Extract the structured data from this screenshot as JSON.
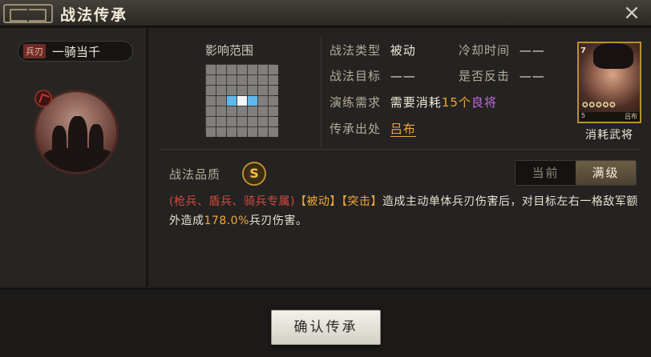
{
  "window": {
    "title": "战法传承",
    "close_icon": "×"
  },
  "skill": {
    "troop_type": "兵刃",
    "name": "一骑当千",
    "icon": "cavalry-charge-portrait"
  },
  "range": {
    "label": "影响范围",
    "grid_size": 7,
    "target_cells": [
      [
        3,
        2
      ],
      [
        3,
        4
      ]
    ],
    "self_cell": [
      3,
      3
    ]
  },
  "info": {
    "type_label": "战法类型",
    "type_value": "被动",
    "cooldown_label": "冷却时间",
    "cooldown_value": "——",
    "target_label": "战法目标",
    "target_value": "——",
    "counter_label": "是否反击",
    "counter_value": "——",
    "drill_label": "演练需求",
    "drill_prefix": "需要消耗",
    "drill_count": "15个",
    "drill_item": "良将",
    "source_label": "传承出处",
    "source_value": "吕布"
  },
  "general_card": {
    "cost": "7",
    "footer_level": "5",
    "footer_name": "吕布",
    "label": "消耗武将"
  },
  "quality": {
    "label": "战法品质",
    "grade": "S"
  },
  "level_toggle": {
    "current": "当前",
    "max": "满级",
    "active": "max"
  },
  "description": {
    "troops": "(枪兵、盾兵、骑兵专属)",
    "tag1": "【被动】",
    "tag2": "【突击】",
    "text1": "造成主动单体兵刃伤害后，对目标左右一格敌军额外造成",
    "value": "178.0%",
    "text2": "兵刃伤害。"
  },
  "confirm_button": "确认传承",
  "colors": {
    "accent_orange": "#f3a83a",
    "rare_purple": "#c768e8",
    "troop_red": "#d34a3a"
  }
}
